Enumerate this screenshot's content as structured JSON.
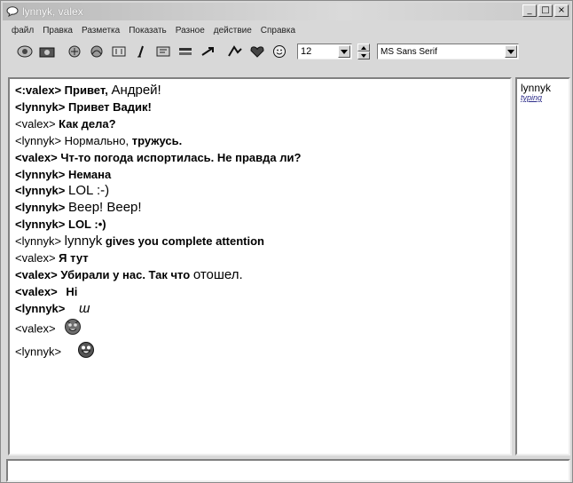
{
  "window": {
    "title": "lynnyk, valex"
  },
  "menu": [
    "файл",
    "Правка",
    "Разметка",
    "Показать",
    "Разное",
    "действие",
    "Справка"
  ],
  "toolbar": {
    "buttons": [
      "notify-icon",
      "camera-icon",
      "stamp-icon",
      "signature-icon",
      "text-box-icon",
      "italic-icon",
      "format-icon",
      "color-bar-icon",
      "arrows-icon",
      "bg-icon",
      "heart-icon",
      "smile-icon"
    ],
    "font_size": "12",
    "font_name": "MS Sans Serif"
  },
  "chat": [
    {
      "nick": "<:valex>",
      "text": "Привет,",
      "text2": "Андрей!"
    },
    {
      "nick": "<lynnyk>",
      "text": "Привет Вадик!"
    },
    {
      "nick": "<valex>",
      "text": "Как дела?"
    },
    {
      "nick": "<lynnyk>",
      "text": "Нормально,",
      "text2": "тружусь."
    },
    {
      "nick": "<valex>",
      "text": "Чт-то погода испортилась. Не правда ли?"
    },
    {
      "nick": "<lynnyk>",
      "text": "Немана"
    },
    {
      "nick": "<lynnyk>",
      "text": "LOL :-)"
    },
    {
      "nick": "<lynnyk>",
      "text": "Beep! Beep!"
    },
    {
      "nick": "<lynnyk>",
      "text": "LOL :•)"
    },
    {
      "nick": "<lynnyk>",
      "text": "lynnyk",
      "text2": "gives you complete attention"
    },
    {
      "nick": "<valex>",
      "text": "Я тут"
    },
    {
      "nick": "<valex>",
      "text": "Убирали у нас. Так что",
      "text2": "отошел."
    },
    {
      "nick": "<valex>",
      "text": "Hi"
    },
    {
      "nick": "<lynnyk>",
      "text": "ш"
    },
    {
      "nick": "<valex>",
      "smiley": "devil-smiley-icon"
    },
    {
      "nick": "<lynnyk>",
      "smiley": "big-grin-smiley-icon"
    }
  ],
  "users": [
    {
      "name": "lynnyk",
      "status": "typing"
    }
  ],
  "input": {
    "value": ""
  }
}
